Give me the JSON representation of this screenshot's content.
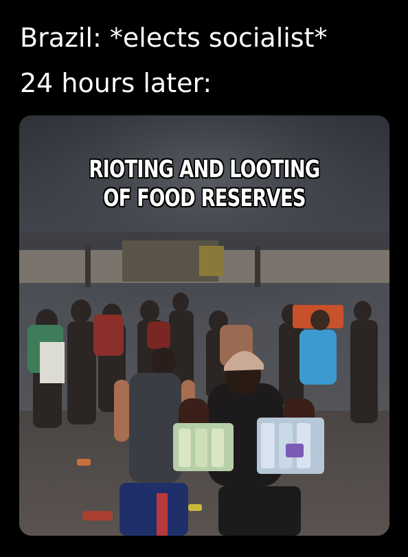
{
  "caption": {
    "line1": "Brazil: *elects socialist*",
    "line2": "24 hours later:"
  },
  "photo": {
    "overlay_line1": "RIOTING AND LOOTING",
    "overlay_line2": "OF FOOD RESERVES",
    "colors": {
      "page_background": "#000000",
      "caption_text": "#ffffff",
      "overlay_text": "#ffffff",
      "overlay_outline": "#000000"
    }
  }
}
